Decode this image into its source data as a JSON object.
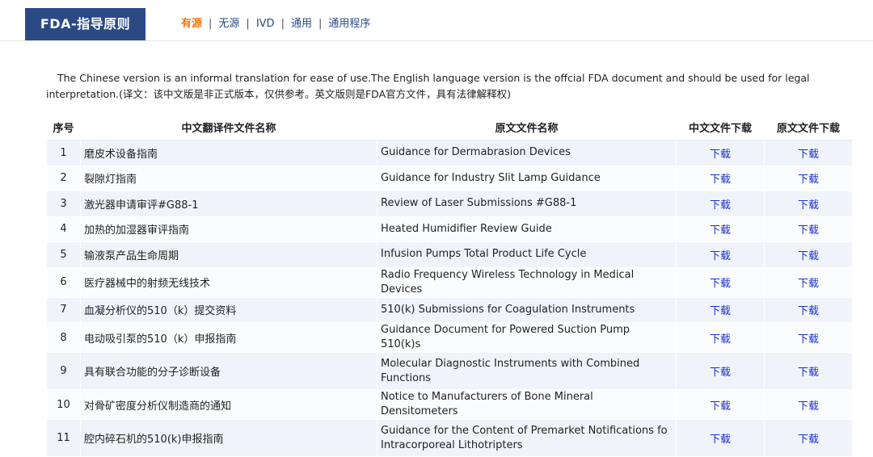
{
  "header": {
    "brand": "FDA-指导原则",
    "nav": [
      {
        "label": "有源",
        "active": true
      },
      {
        "label": "无源",
        "active": false
      },
      {
        "label": "IVD",
        "active": false
      },
      {
        "label": "通用",
        "active": false
      },
      {
        "label": "通用程序",
        "active": false
      }
    ],
    "separator": "|"
  },
  "notice": "The Chinese version is an informal translation for ease of use.The English language version is the offcial FDA document and should be used for legal interpretation.(译文：该中文版是非正式版本，仅供参考。英文版则是FDA官方文件，具有法律解释权)",
  "table": {
    "columns": [
      "序号",
      "中文翻译件文件名称",
      "原文文件名称",
      "中文文件下载",
      "原文文件下载"
    ],
    "rows": [
      {
        "no": "1",
        "zh": "磨皮术设备指南",
        "en": "Guidance for Dermabrasion Devices",
        "zh_dl": "下载",
        "en_dl": "下载"
      },
      {
        "no": "2",
        "zh": "裂隙灯指南",
        "en": "Guidance for Industry Slit Lamp Guidance",
        "zh_dl": "下载",
        "en_dl": "下载"
      },
      {
        "no": "3",
        "zh": "激光器申请审评#G88-1",
        "en": "Review of Laser Submissions #G88-1",
        "zh_dl": "下载",
        "en_dl": "下载"
      },
      {
        "no": "4",
        "zh": "加热的加湿器审评指南",
        "en": "Heated Humidifier Review Guide",
        "zh_dl": "下载",
        "en_dl": "下载"
      },
      {
        "no": "5",
        "zh": "输液泵产品生命周期",
        "en": "Infusion Pumps Total Product Life Cycle",
        "zh_dl": "下载",
        "en_dl": "下载"
      },
      {
        "no": "6",
        "zh": "医疗器械中的射频无线技术",
        "en": "Radio Frequency Wireless Technology in Medical Devices",
        "zh_dl": "下载",
        "en_dl": "下载"
      },
      {
        "no": "7",
        "zh": "血凝分析仪的510（k）提交资料",
        "en": "510(k) Submissions for Coagulation Instruments",
        "zh_dl": "下载",
        "en_dl": "下载"
      },
      {
        "no": "8",
        "zh": "电动吸引泵的510（k）申报指南",
        "en": "Guidance Document for Powered Suction Pump 510(k)s",
        "zh_dl": "下载",
        "en_dl": "下载"
      },
      {
        "no": "9",
        "zh": "具有联合功能的分子诊断设备",
        "en": "Molecular Diagnostic Instruments with Combined Functions",
        "zh_dl": "下载",
        "en_dl": "下载"
      },
      {
        "no": "10",
        "zh": "对骨矿密度分析仪制造商的通知",
        "en": "Notice to Manufacturers of Bone Mineral Densitometers",
        "zh_dl": "下载",
        "en_dl": "下载"
      },
      {
        "no": "11",
        "zh": "腔内碎石机的510(k)申报指南",
        "en": "Guidance for the Content of Premarket Notifications fo Intracorporeal Lithotripters",
        "zh_dl": "下载",
        "en_dl": "下载"
      }
    ]
  },
  "colors": {
    "brand_bg": "#2a4a86",
    "nav_active": "#f07a10",
    "link": "#1a2fd0",
    "row_stripe": "#f0f4fa"
  }
}
